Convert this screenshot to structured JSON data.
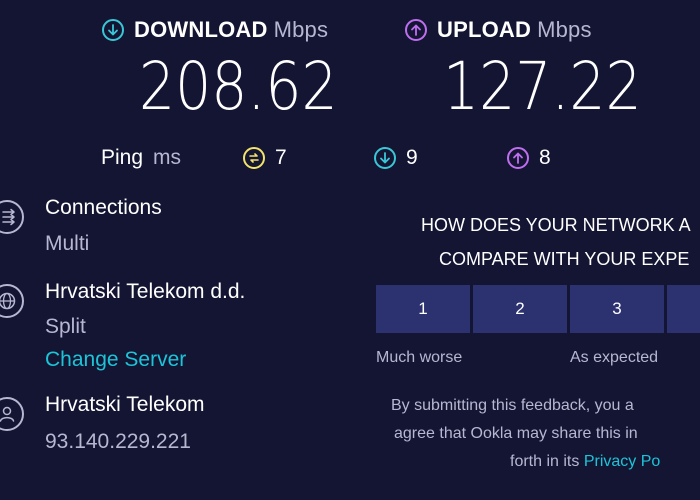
{
  "download": {
    "label": "DOWNLOAD",
    "unit": "Mbps",
    "value": "208.62",
    "color": "#39c7d6",
    "icon": "download-arrow-icon"
  },
  "upload": {
    "label": "UPLOAD",
    "unit": "Mbps",
    "value": "127.22",
    "color": "#c06ef0",
    "icon": "upload-arrow-icon"
  },
  "ping": {
    "label": "Ping",
    "unit": "ms",
    "idle": {
      "value": "7",
      "color": "#f2e36a",
      "icon": "idle-latency-icon"
    },
    "download": {
      "value": "9",
      "color": "#39c7d6",
      "icon": "download-latency-icon"
    },
    "upload": {
      "value": "8",
      "color": "#c06ef0",
      "icon": "upload-latency-icon"
    }
  },
  "connections": {
    "title": "Connections",
    "value": "Multi",
    "icon": "connections-icon"
  },
  "server": {
    "name": "Hrvatski Telekom d.d.",
    "location": "Split",
    "change_label": "Change Server",
    "icon": "globe-icon"
  },
  "isp": {
    "name": "Hrvatski Telekom",
    "ip": "93.140.229.221",
    "icon": "user-icon"
  },
  "survey": {
    "question_line1": "HOW DOES YOUR NETWORK A",
    "question_line2": "COMPARE WITH YOUR EXPE",
    "ratings": [
      "1",
      "2",
      "3"
    ],
    "scale_low": "Much worse",
    "scale_mid": "As expected",
    "disclaimer_line1": "By submitting this feedback, you a",
    "disclaimer_line2": "agree that Ookla may share this in",
    "disclaimer_line3_prefix": "forth in its ",
    "privacy_link": "Privacy Po"
  },
  "colors": {
    "background": "#141533",
    "muted_text": "#b7b7d1",
    "link": "#1cc4d8",
    "rating_button": "#2c3170"
  }
}
